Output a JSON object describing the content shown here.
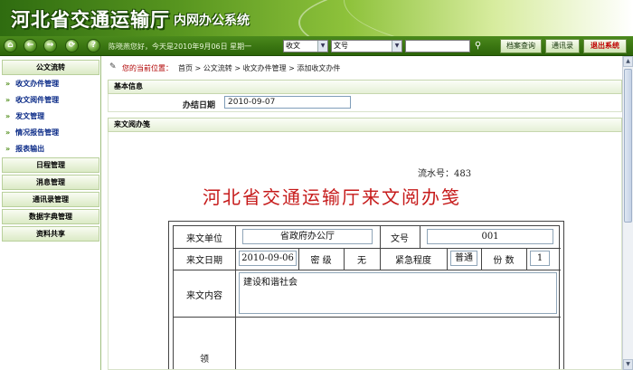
{
  "header": {
    "title": "河北省交通运输厅",
    "subtitle": "内网办公系统"
  },
  "toolbar": {
    "nav_icons": [
      "home-icon",
      "back-arrow-icon",
      "forward-arrow-icon",
      "refresh-icon",
      "help-icon"
    ],
    "greeting": "陈晓燕您好，今天是2010年9月06日 星期一",
    "category_select": "收文",
    "field_select": "文号",
    "search_value": "",
    "buttons": [
      "档案查询",
      "通讯录",
      "退出系统"
    ]
  },
  "sidebar": {
    "section": "公文流转",
    "items": [
      "收文办件管理",
      "收文阅件管理",
      "发文管理",
      "情况报告管理",
      "报表输出"
    ],
    "sections": [
      "日程管理",
      "消息管理",
      "通讯录管理",
      "数据字典管理",
      "资料共享"
    ]
  },
  "breadcrumb": {
    "label": "您的当前位置：",
    "path": "首页 > 公文流转 > 收文办件管理 > 添加收文办件"
  },
  "basic_info": {
    "heading": "基本信息",
    "date_label": "办结日期",
    "date_value": "2010-09-07"
  },
  "form": {
    "heading": "来文阅办笺",
    "serial_label": "流水号：",
    "serial_value": "483",
    "title": "河北省交通运输厅来文阅办笺",
    "from_label": "来文单位",
    "from_value": "省政府办公厅",
    "docno_label": "文号",
    "docno_value": "001",
    "date_label": "来文日期",
    "date_value": "2010-09-06",
    "secret_label": "密 级",
    "secret_value": "无",
    "urgency_label": "紧急程度",
    "urgency_value": "普通",
    "copies_label": "份 数",
    "copies_value": "1",
    "content_label": "来文内容",
    "content_value": "建设和谐社会",
    "next_label": "领"
  },
  "colors": {
    "banner_green": "#57951f",
    "toolbar_green": "#3c7814",
    "title_red": "#c61a1a",
    "link_blue": "#0a2a87"
  }
}
